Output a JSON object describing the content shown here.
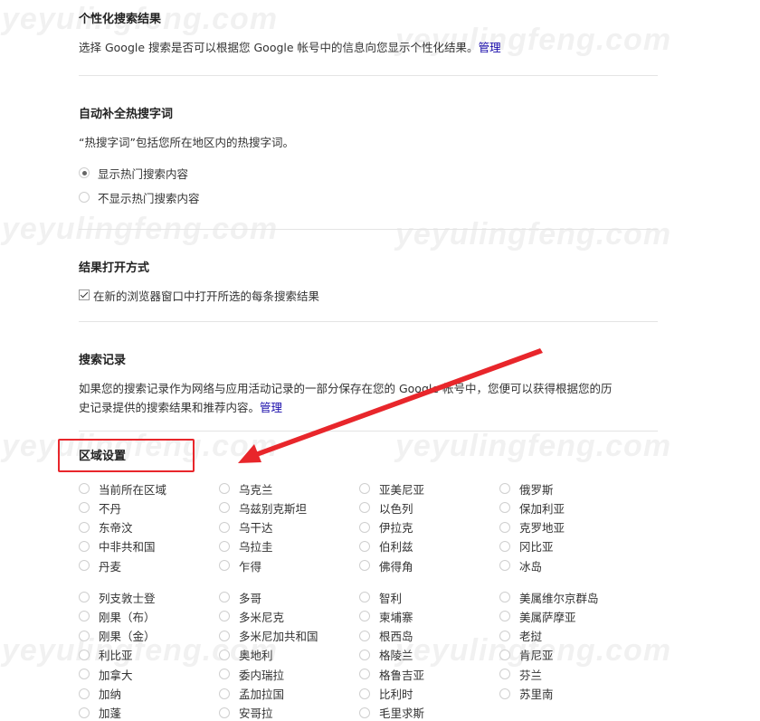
{
  "watermark": "yeyulingfeng.com",
  "personalized": {
    "title": "个性化搜索结果",
    "desc": "选择 Google 搜索是否可以根据您 Google 帐号中的信息向您显示个性化结果。",
    "link": "管理"
  },
  "autocomplete": {
    "title": "自动补全热搜字词",
    "desc": "“热搜字词”包括您所在地区内的热搜字词。",
    "options": [
      {
        "label": "显示热门搜索内容",
        "selected": true
      },
      {
        "label": "不显示热门搜索内容",
        "selected": false
      }
    ]
  },
  "open_results": {
    "title": "结果打开方式",
    "checkbox_label": "在新的浏览器窗口中打开所选的每条搜索结果",
    "checked": true
  },
  "history": {
    "title": "搜索记录",
    "desc_line1": "如果您的搜索记录作为网络与应用活动记录的一部分保存在您的 Google 帐号中，您便可以获得根据您的历",
    "desc_line2": "史记录提供的搜索结果和推荐内容。",
    "link": "管理"
  },
  "region": {
    "title": "区域设置",
    "group1": [
      [
        "当前所在区域",
        "不丹",
        "东帝汶",
        "中非共和国",
        "丹麦"
      ],
      [
        "乌克兰",
        "乌兹别克斯坦",
        "乌干达",
        "乌拉圭",
        "乍得"
      ],
      [
        "亚美尼亚",
        "以色列",
        "伊拉克",
        "伯利兹",
        "佛得角"
      ],
      [
        "俄罗斯",
        "保加利亚",
        "克罗地亚",
        "冈比亚",
        "冰岛"
      ]
    ],
    "group2": [
      [
        "列支敦士登",
        "刚果（布）",
        "刚果（金）",
        "利比亚",
        "加拿大",
        "加纳",
        "加蓬"
      ],
      [
        "多哥",
        "多米尼克",
        "多米尼加共和国",
        "奥地利",
        "委内瑞拉",
        "孟加拉国",
        "安哥拉"
      ],
      [
        "智利",
        "柬埔寨",
        "根西岛",
        "格陵兰",
        "格鲁吉亚",
        "比利时",
        "毛里求斯"
      ],
      [
        "美属维尔京群岛",
        "美属萨摩亚",
        "老挝",
        "肯尼亚",
        "芬兰",
        "苏里南"
      ]
    ]
  },
  "colors": {
    "link": "#1a0dab",
    "annotation": "#e8262b",
    "divider": "#e4e4e4"
  }
}
